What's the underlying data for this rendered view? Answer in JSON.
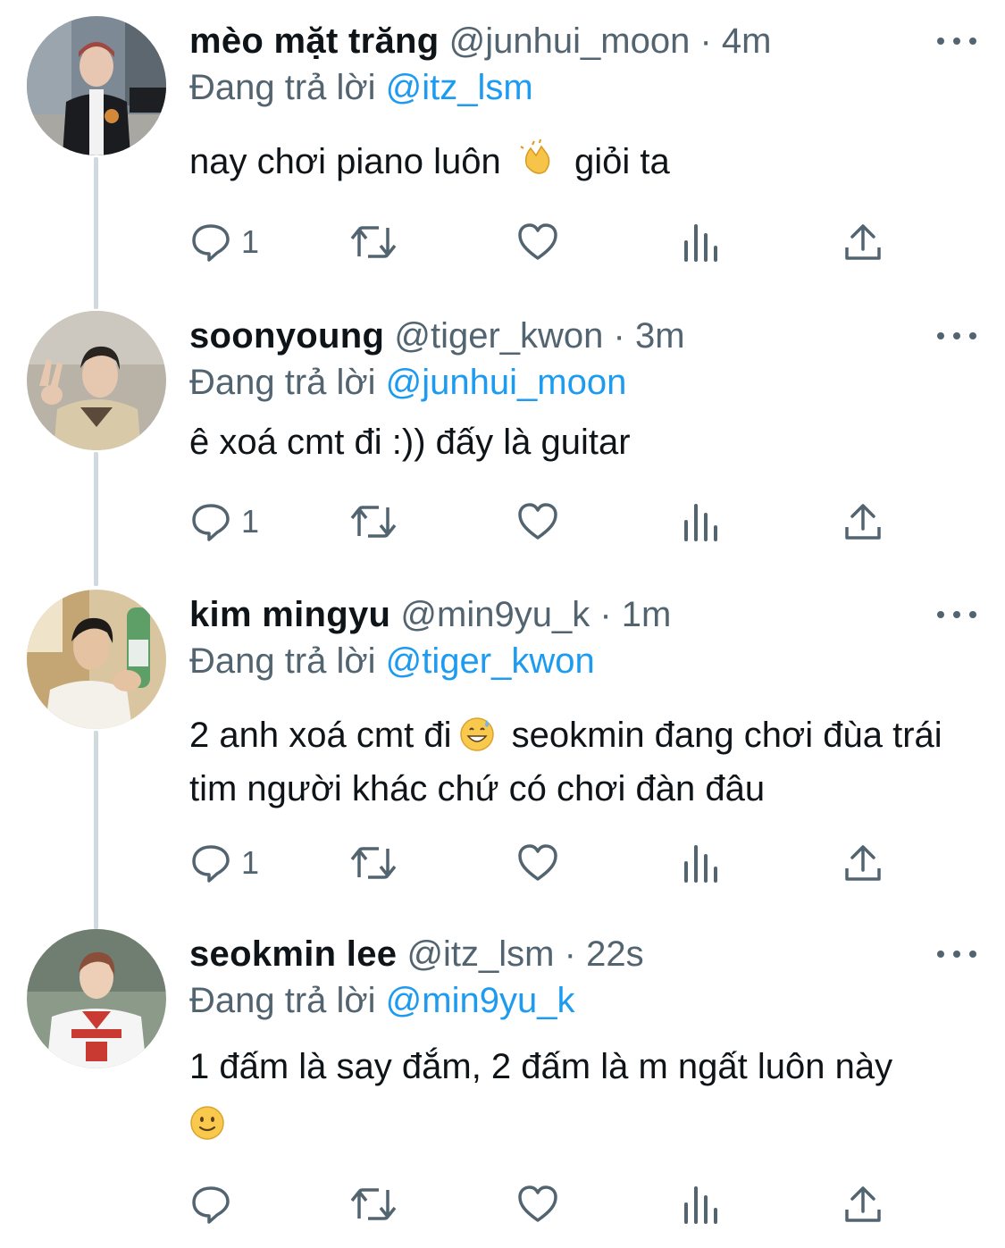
{
  "colors": {
    "text": "#0f1419",
    "secondary": "#536471",
    "accent": "#1d9bf0",
    "thread_line": "#cfd9de"
  },
  "replying_prefix": "Đang trả lời",
  "tweets": [
    {
      "name": "mèo mặt trăng",
      "handle": "@junhui_moon",
      "separator": "·",
      "time": "4m",
      "replying_to": "@itz_lsm",
      "text_a": "nay chơi piano luôn",
      "emoji": "clapping-hands",
      "text_b": "giỏi ta",
      "reply_count": "1",
      "avatar": "avatar-junhui"
    },
    {
      "name": "soonyoung",
      "handle": "@tiger_kwon",
      "separator": "·",
      "time": "3m",
      "replying_to": "@junhui_moon",
      "text_a": "ê xoá cmt đi :)) đấy là guitar",
      "reply_count": "1",
      "avatar": "avatar-soonyoung"
    },
    {
      "name": "kim mingyu",
      "handle": "@min9yu_k",
      "separator": "·",
      "time": "1m",
      "replying_to": "@tiger_kwon",
      "text_a": "2 anh xoá cmt đi",
      "emoji": "grinning-face-with-sweat",
      "text_b": "seokmin đang chơi đùa trái tim người khác chứ có chơi đàn đâu",
      "reply_count": "1",
      "avatar": "avatar-mingyu"
    },
    {
      "name": "seokmin lee",
      "handle": "@itz_lsm",
      "separator": "·",
      "time": "22s",
      "replying_to": "@min9yu_k",
      "text_a": "1 đấm là say đắm, 2 đấm là m ngất luôn này",
      "emoji": "slightly-smiling-face",
      "reply_count": "",
      "avatar": "avatar-seokmin"
    }
  ]
}
